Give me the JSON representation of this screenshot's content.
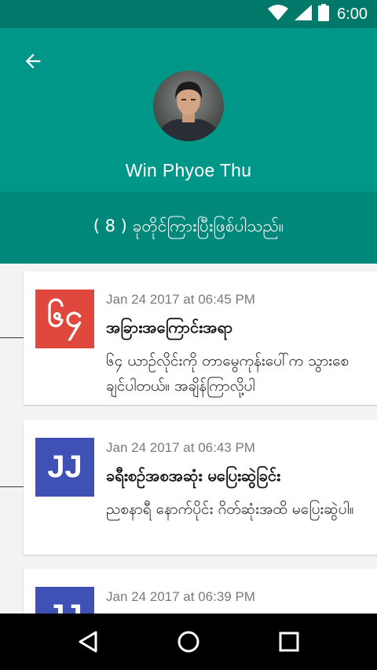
{
  "status_bar": {
    "time": "6:00",
    "icons": [
      "wifi-icon",
      "signal-icon",
      "battery-icon"
    ]
  },
  "colors": {
    "status_bar": "#00796b",
    "header": "#009688",
    "subheader": "#00897b",
    "thumb_red": "#e0483e",
    "thumb_blue": "#3f51b5"
  },
  "profile": {
    "name": "Win Phyoe Thu",
    "avatar_icon": "avatar-photo"
  },
  "subheader": {
    "text": "( 8 ) ခုတိုင်ကြားပြီးဖြစ်ပါသည်။"
  },
  "posts": [
    {
      "thumb_text": "၆၄",
      "thumb_color": "#e0483e",
      "date": "Jan 24 2017 at 06:45 PM",
      "title": "အခြားအကြောင်းအရာ",
      "body": "၆၄ ယာဉ်လိုင်းကို တာမွေကုန်းပေါ်က သွားစေချင်ပါတယ်။ အချိန်ကြာလို့ပါ"
    },
    {
      "thumb_text": "JJ",
      "thumb_color": "#3f51b5",
      "date": "Jan 24 2017 at 06:43 PM",
      "title": "ခရီးစဉ်အစအဆုံး မပြေးဆွဲခြင်း",
      "body": "ညစနာရီ နောက်ပိုင်း ဂိတ်ဆုံးအထိ မပြေးဆွဲပါ။"
    },
    {
      "thumb_text": "JJ",
      "thumb_color": "#3f51b5",
      "date": "Jan 24 2017 at 06:39 PM",
      "title": "",
      "body": ""
    }
  ]
}
